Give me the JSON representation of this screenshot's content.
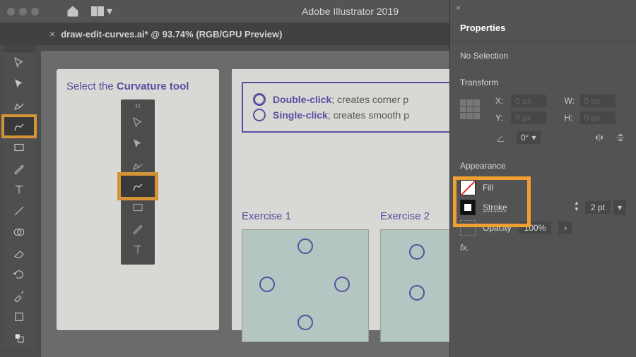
{
  "app": {
    "title": "Adobe Illustrator 2019"
  },
  "tab": {
    "label": "draw-edit-curves.ai* @ 93.74% (RGB/GPU Preview)"
  },
  "tutorial": {
    "select_prefix": "Select the ",
    "select_bold": "Curvature tool",
    "double_bold": "Double-click",
    "single_bold": "Single-click",
    "double_rest": "; creates corner p",
    "single_rest": "; creates smooth p"
  },
  "exercises": {
    "ex1": "Exercise 1",
    "ex2": "Exercise 2"
  },
  "props": {
    "panel_title": "Properties",
    "no_selection": "No Selection",
    "transform": "Transform",
    "x": "X:",
    "y": "Y:",
    "w": "W:",
    "h": "H:",
    "x_val": "0 px",
    "y_val": "0 px",
    "w_val": "0 px",
    "h_val": "0 px",
    "angle_val": "0°",
    "appearance": "Appearance",
    "fill": "Fill",
    "stroke": "Stroke",
    "stroke_weight": "2 pt",
    "opacity": "Opacity",
    "opacity_val": "100%",
    "fx": "fx."
  }
}
